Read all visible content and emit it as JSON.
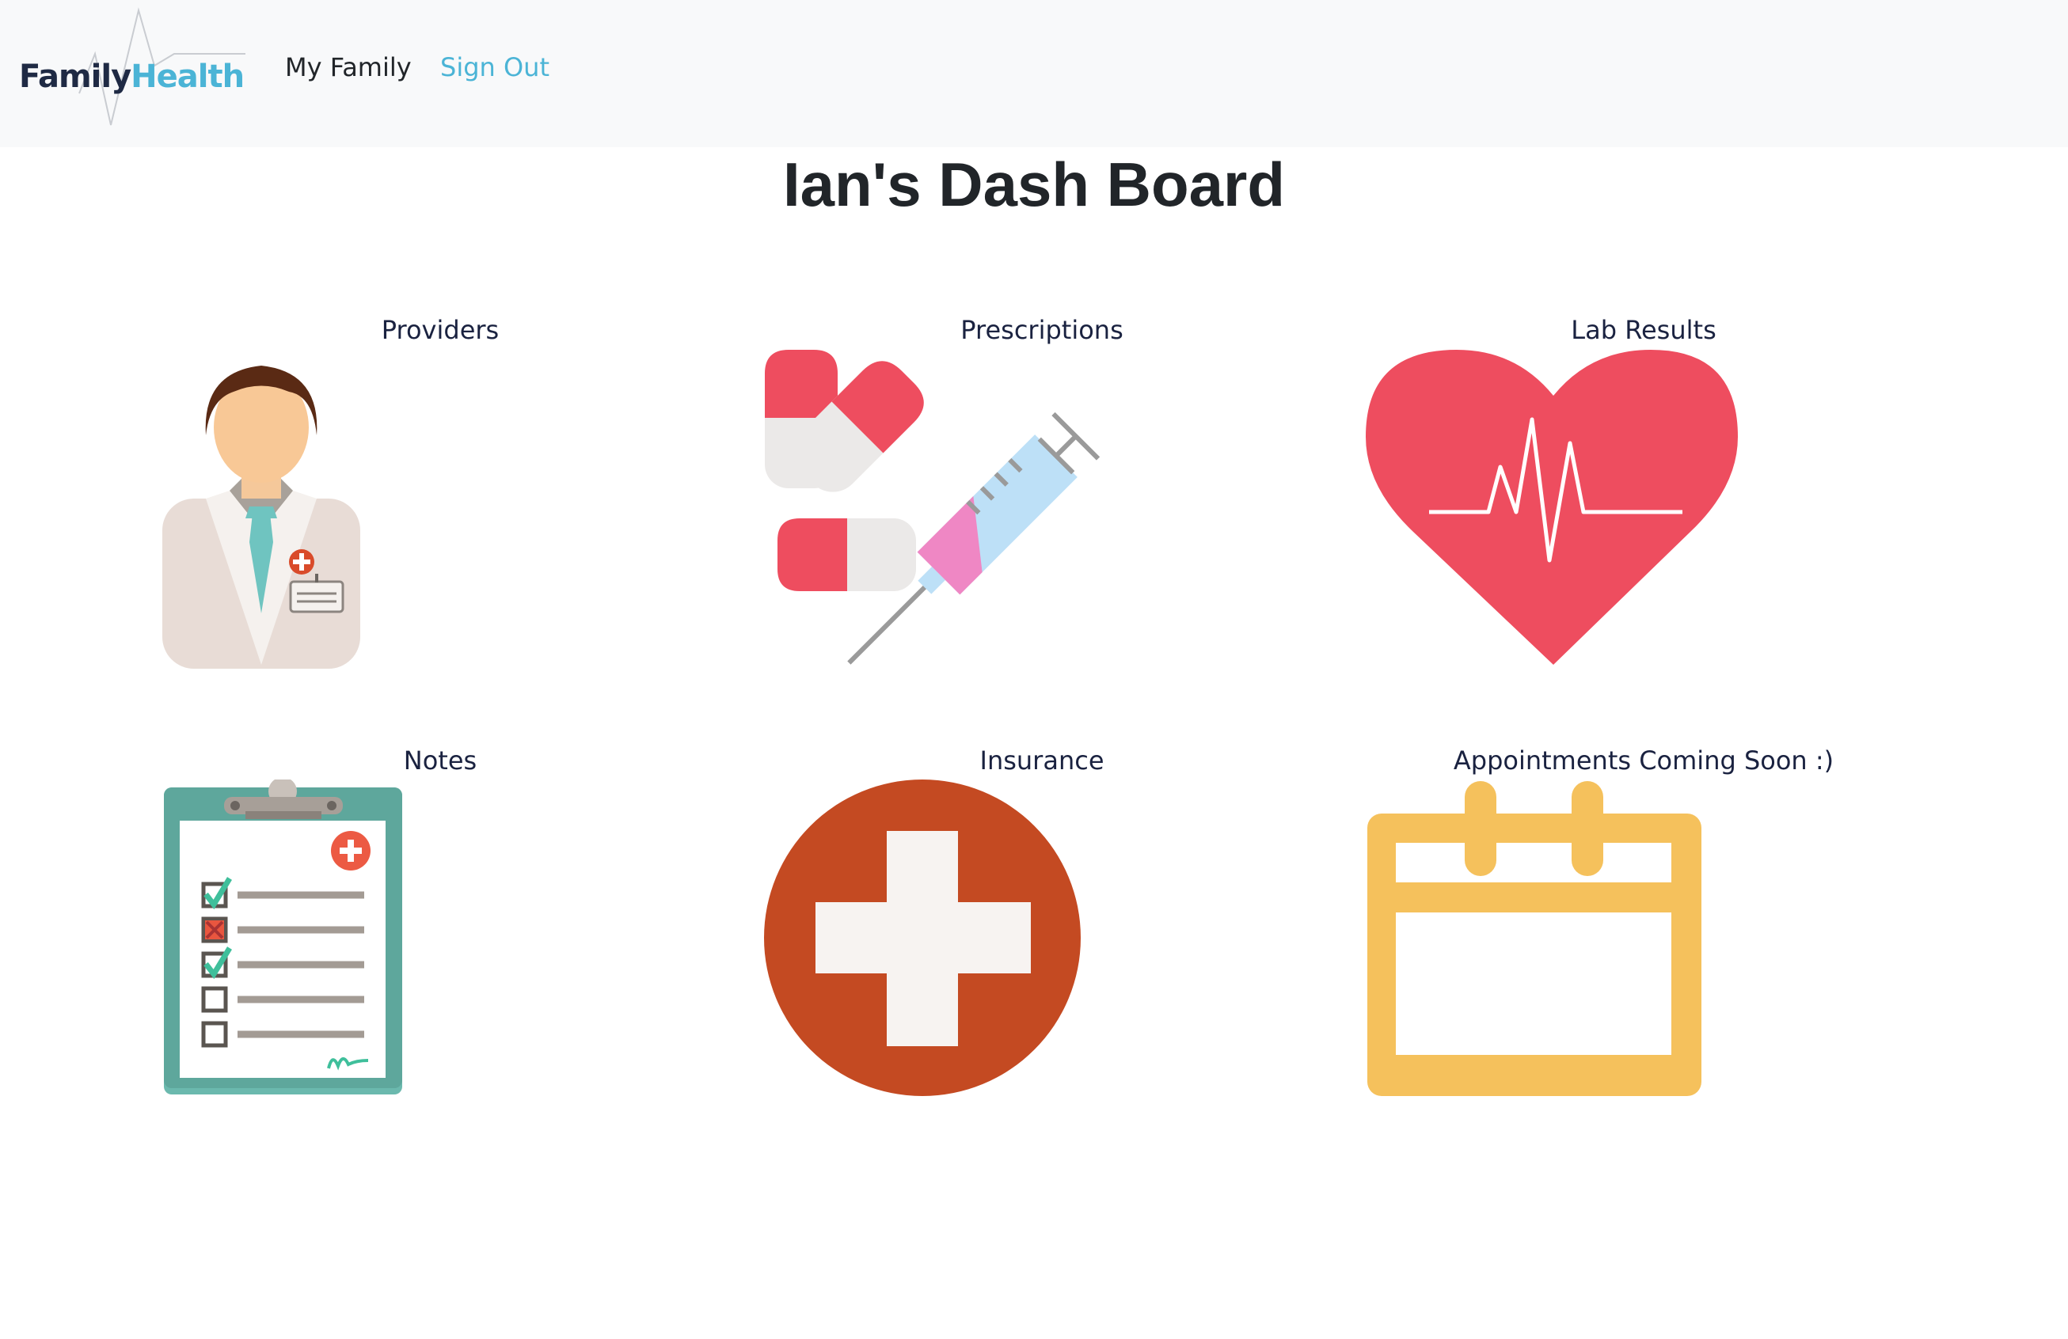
{
  "navbar": {
    "brand_part1": "Family",
    "brand_part2": "Health",
    "links": [
      "My Family",
      "Sign Out"
    ]
  },
  "page": {
    "title": "Ian's Dash Board"
  },
  "tiles": [
    {
      "label": "Providers",
      "icon": "doctor-icon"
    },
    {
      "label": "Prescriptions",
      "icon": "pills-syringe-icon"
    },
    {
      "label": "Lab Results",
      "icon": "heartbeat-icon"
    },
    {
      "label": "Notes",
      "icon": "clipboard-icon"
    },
    {
      "label": "Insurance",
      "icon": "medical-cross-icon"
    },
    {
      "label": "Appointments Coming Soon :)",
      "icon": "calendar-icon"
    }
  ],
  "colors": {
    "accent": "#4bb4d6",
    "navbar_bg": "#f8f9fa",
    "heart_red": "#ee4d5f",
    "cross_orange": "#c44a22",
    "calendar_yellow": "#f5c15c",
    "clipboard_teal": "#6bb9ae"
  }
}
